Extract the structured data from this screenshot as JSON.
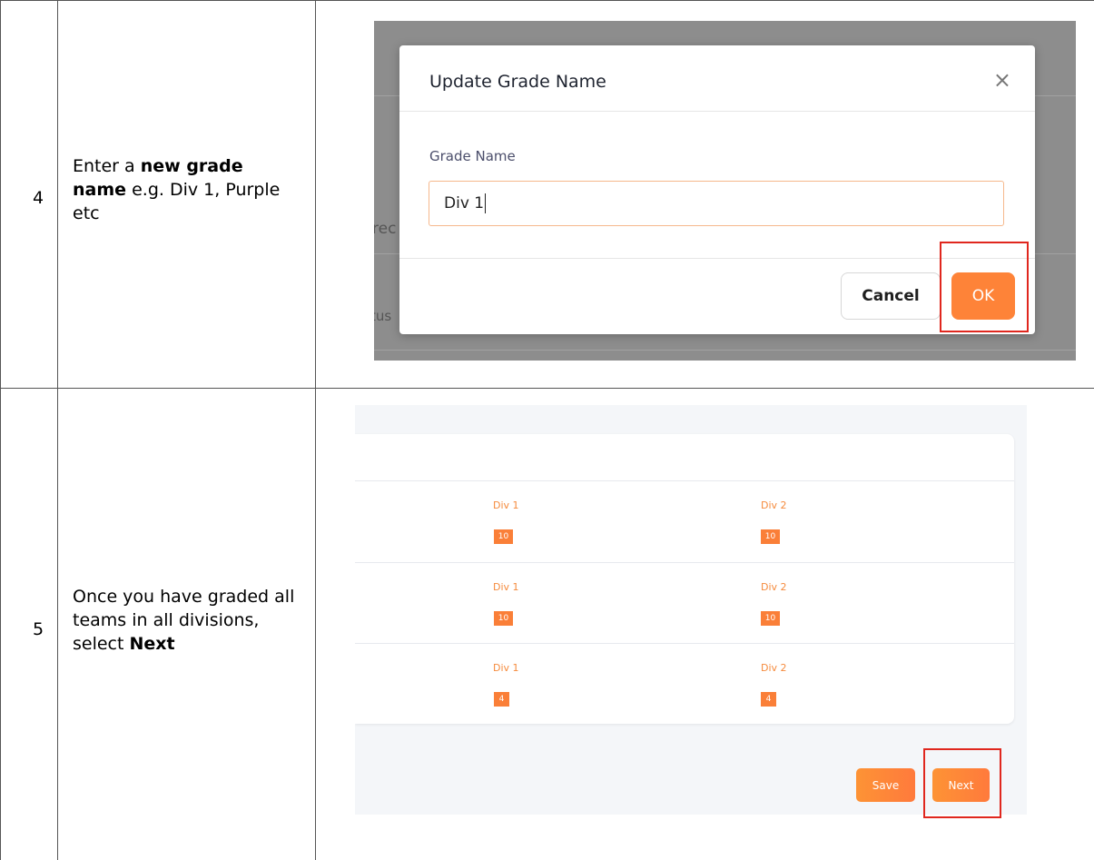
{
  "table": {
    "rows": [
      {
        "step": "4",
        "instruction": {
          "pre": "Enter a ",
          "bold": "new grade name",
          "post": " e.g. Div 1, Purple etc"
        }
      },
      {
        "step": "5",
        "instruction": {
          "pre": "Once you have graded all teams in all divisions, select ",
          "bold": "Next",
          "post": ""
        }
      }
    ]
  },
  "shot1": {
    "background_fragments": [
      "rec",
      "tus"
    ],
    "modal": {
      "title": "Update Grade Name",
      "close_glyph": "×",
      "field_label": "Grade Name",
      "field_value": "Div 1",
      "cancel_label": "Cancel",
      "ok_label": "OK"
    }
  },
  "shot2": {
    "rows": [
      {
        "col1_label": "Div 1",
        "col1_value": "10",
        "col2_label": "Div 2",
        "col2_value": "10"
      },
      {
        "col1_label": "Div 1",
        "col1_value": "10",
        "col2_label": "Div 2",
        "col2_value": "10"
      },
      {
        "col1_label": "Div 1",
        "col1_value": "4",
        "col2_label": "Div 2",
        "col2_value": "4"
      }
    ],
    "save_label": "Save",
    "next_label": "Next"
  },
  "colors": {
    "accent": "#fe8338",
    "highlight": "#e0271e"
  }
}
